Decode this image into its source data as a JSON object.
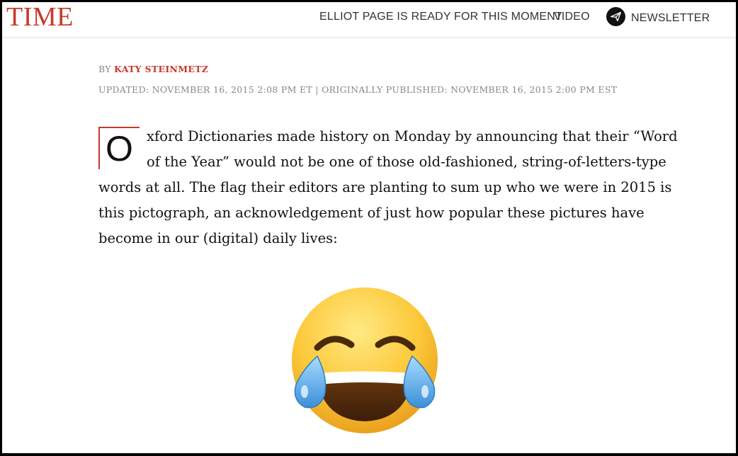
{
  "header": {
    "logo": "TIME",
    "nav": {
      "headline": "ELLIOT PAGE IS READY FOR THIS MOMENT",
      "video": "VIDEO",
      "newsletter": "NEWSLETTER"
    }
  },
  "article": {
    "byline_prefix": "BY",
    "author": "KATY STEINMETZ",
    "timestamp": "UPDATED: NOVEMBER 16, 2015 2:08 PM ET | ORIGINALLY PUBLISHED: NOVEMBER 16, 2015 2:00 PM EST",
    "dropcap": "O",
    "body": "xford Dictionaries made history on Monday by announcing that their “Word of the Year” would not be one of those old-fashioned, string-of-letters-type words at all. The flag their editors are planting to sum up who we were in 2015 is this pictograph, an acknowledgement of just how popular these pictures have become in our (digital) daily lives:",
    "image_icon": "face-with-tears-of-joy-emoji"
  },
  "colors": {
    "brand_red": "#c8392b",
    "text": "#111111",
    "meta_gray": "#888888"
  }
}
